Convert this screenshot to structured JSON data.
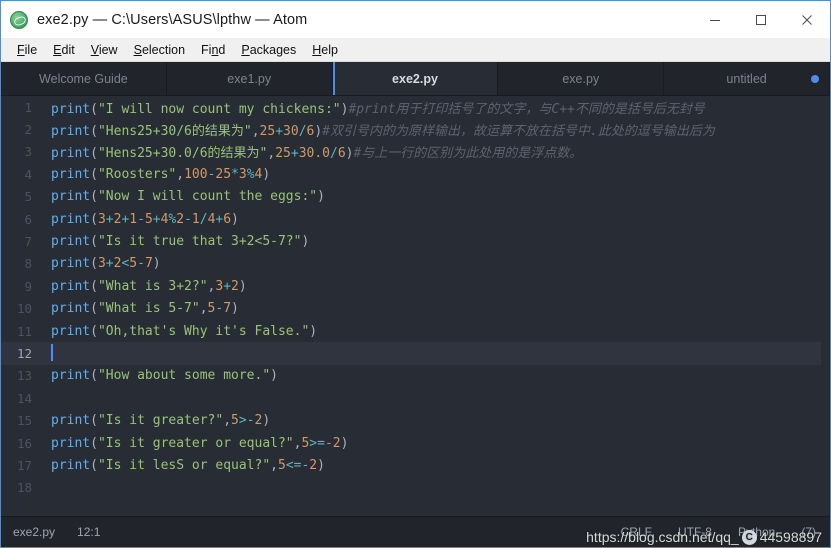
{
  "window": {
    "title": "exe2.py — C:\\Users\\ASUS\\lpthw — Atom",
    "app_icon": "atom-icon",
    "controls": {
      "minimize": "minimize-icon",
      "maximize": "maximize-icon",
      "close": "close-icon"
    }
  },
  "menubar": {
    "items": [
      {
        "label": "File",
        "mnemonic": "F"
      },
      {
        "label": "Edit",
        "mnemonic": "E"
      },
      {
        "label": "View",
        "mnemonic": "V"
      },
      {
        "label": "Selection",
        "mnemonic": "S"
      },
      {
        "label": "Find",
        "mnemonic": "n"
      },
      {
        "label": "Packages",
        "mnemonic": "P"
      },
      {
        "label": "Help",
        "mnemonic": "H"
      }
    ]
  },
  "tabs": [
    {
      "label": "Welcome Guide",
      "active": false,
      "modified": false
    },
    {
      "label": "exe1.py",
      "active": false,
      "modified": false
    },
    {
      "label": "exe2.py",
      "active": true,
      "modified": false
    },
    {
      "label": "exe.py",
      "active": false,
      "modified": false
    },
    {
      "label": "untitled",
      "active": false,
      "modified": true
    }
  ],
  "editor": {
    "active_line": 12,
    "lines": [
      {
        "n": "1",
        "tokens": [
          {
            "t": "fn",
            "v": "print"
          },
          {
            "t": "pun",
            "v": "("
          },
          {
            "t": "str",
            "v": "\"I will now count my chickens:\""
          },
          {
            "t": "pun",
            "v": ")"
          },
          {
            "t": "com",
            "v": "#print用于打印括号了的文字，与C++不同的是括号后无封号"
          }
        ]
      },
      {
        "n": "2",
        "tokens": [
          {
            "t": "fn",
            "v": "print"
          },
          {
            "t": "pun",
            "v": "("
          },
          {
            "t": "str",
            "v": "\"Hens25+30/6的结果为\""
          },
          {
            "t": "pun",
            "v": ","
          },
          {
            "t": "num",
            "v": "25"
          },
          {
            "t": "op",
            "v": "+"
          },
          {
            "t": "num",
            "v": "30"
          },
          {
            "t": "op",
            "v": "/"
          },
          {
            "t": "num",
            "v": "6"
          },
          {
            "t": "pun",
            "v": ")"
          },
          {
            "t": "com",
            "v": "#双引号内的为原样输出，故运算不放在括号中.此处的逗号输出后为"
          }
        ]
      },
      {
        "n": "3",
        "tokens": [
          {
            "t": "fn",
            "v": "print"
          },
          {
            "t": "pun",
            "v": "("
          },
          {
            "t": "str",
            "v": "\"Hens25+30.0/6的结果为\""
          },
          {
            "t": "pun",
            "v": ","
          },
          {
            "t": "num",
            "v": "25"
          },
          {
            "t": "op",
            "v": "+"
          },
          {
            "t": "num",
            "v": "30.0"
          },
          {
            "t": "op",
            "v": "/"
          },
          {
            "t": "num",
            "v": "6"
          },
          {
            "t": "pun",
            "v": ")"
          },
          {
            "t": "com",
            "v": "#与上一行的区别为此处用的是浮点数。"
          }
        ]
      },
      {
        "n": "4",
        "tokens": [
          {
            "t": "fn",
            "v": "print"
          },
          {
            "t": "pun",
            "v": "("
          },
          {
            "t": "str",
            "v": "\"Roosters\""
          },
          {
            "t": "pun",
            "v": ","
          },
          {
            "t": "num",
            "v": "100"
          },
          {
            "t": "op",
            "v": "-"
          },
          {
            "t": "num",
            "v": "25"
          },
          {
            "t": "op",
            "v": "*"
          },
          {
            "t": "num",
            "v": "3"
          },
          {
            "t": "op",
            "v": "%"
          },
          {
            "t": "num",
            "v": "4"
          },
          {
            "t": "pun",
            "v": ")"
          }
        ]
      },
      {
        "n": "5",
        "tokens": [
          {
            "t": "fn",
            "v": "print"
          },
          {
            "t": "pun",
            "v": "("
          },
          {
            "t": "str",
            "v": "\"Now I will count the eggs:\""
          },
          {
            "t": "pun",
            "v": ")"
          }
        ]
      },
      {
        "n": "6",
        "tokens": [
          {
            "t": "fn",
            "v": "print"
          },
          {
            "t": "pun",
            "v": "("
          },
          {
            "t": "num",
            "v": "3"
          },
          {
            "t": "op",
            "v": "+"
          },
          {
            "t": "num",
            "v": "2"
          },
          {
            "t": "op",
            "v": "+"
          },
          {
            "t": "num",
            "v": "1"
          },
          {
            "t": "op",
            "v": "-"
          },
          {
            "t": "num",
            "v": "5"
          },
          {
            "t": "op",
            "v": "+"
          },
          {
            "t": "num",
            "v": "4"
          },
          {
            "t": "op",
            "v": "%"
          },
          {
            "t": "num",
            "v": "2"
          },
          {
            "t": "op",
            "v": "-"
          },
          {
            "t": "num",
            "v": "1"
          },
          {
            "t": "op",
            "v": "/"
          },
          {
            "t": "num",
            "v": "4"
          },
          {
            "t": "op",
            "v": "+"
          },
          {
            "t": "num",
            "v": "6"
          },
          {
            "t": "pun",
            "v": ")"
          }
        ]
      },
      {
        "n": "7",
        "tokens": [
          {
            "t": "fn",
            "v": "print"
          },
          {
            "t": "pun",
            "v": "("
          },
          {
            "t": "str",
            "v": "\"Is it true that 3+2<5-7?\""
          },
          {
            "t": "pun",
            "v": ")"
          }
        ]
      },
      {
        "n": "8",
        "tokens": [
          {
            "t": "fn",
            "v": "print"
          },
          {
            "t": "pun",
            "v": "("
          },
          {
            "t": "num",
            "v": "3"
          },
          {
            "t": "op",
            "v": "+"
          },
          {
            "t": "num",
            "v": "2"
          },
          {
            "t": "op",
            "v": "<"
          },
          {
            "t": "num",
            "v": "5"
          },
          {
            "t": "op",
            "v": "-"
          },
          {
            "t": "num",
            "v": "7"
          },
          {
            "t": "pun",
            "v": ")"
          }
        ]
      },
      {
        "n": "9",
        "tokens": [
          {
            "t": "fn",
            "v": "print"
          },
          {
            "t": "pun",
            "v": "("
          },
          {
            "t": "str",
            "v": "\"What is 3+2?\""
          },
          {
            "t": "pun",
            "v": ","
          },
          {
            "t": "num",
            "v": "3"
          },
          {
            "t": "op",
            "v": "+"
          },
          {
            "t": "num",
            "v": "2"
          },
          {
            "t": "pun",
            "v": ")"
          }
        ]
      },
      {
        "n": "10",
        "tokens": [
          {
            "t": "fn",
            "v": "print"
          },
          {
            "t": "pun",
            "v": "("
          },
          {
            "t": "str",
            "v": "\"What is 5-7\""
          },
          {
            "t": "pun",
            "v": ","
          },
          {
            "t": "num",
            "v": "5"
          },
          {
            "t": "op",
            "v": "-"
          },
          {
            "t": "num",
            "v": "7"
          },
          {
            "t": "pun",
            "v": ")"
          }
        ]
      },
      {
        "n": "11",
        "tokens": [
          {
            "t": "fn",
            "v": "print"
          },
          {
            "t": "pun",
            "v": "("
          },
          {
            "t": "str",
            "v": "\"Oh,that's Why it's False.\""
          },
          {
            "t": "pun",
            "v": ")"
          }
        ]
      },
      {
        "n": "12",
        "tokens": [],
        "cursor": true
      },
      {
        "n": "13",
        "tokens": [
          {
            "t": "fn",
            "v": "print"
          },
          {
            "t": "pun",
            "v": "("
          },
          {
            "t": "str",
            "v": "\"How about some more.\""
          },
          {
            "t": "pun",
            "v": ")"
          }
        ]
      },
      {
        "n": "14",
        "tokens": []
      },
      {
        "n": "15",
        "tokens": [
          {
            "t": "fn",
            "v": "print"
          },
          {
            "t": "pun",
            "v": "("
          },
          {
            "t": "str",
            "v": "\"Is it greater?\""
          },
          {
            "t": "pun",
            "v": ","
          },
          {
            "t": "num",
            "v": "5"
          },
          {
            "t": "op",
            "v": ">"
          },
          {
            "t": "op",
            "v": "-"
          },
          {
            "t": "num",
            "v": "2"
          },
          {
            "t": "pun",
            "v": ")"
          }
        ]
      },
      {
        "n": "16",
        "tokens": [
          {
            "t": "fn",
            "v": "print"
          },
          {
            "t": "pun",
            "v": "("
          },
          {
            "t": "str",
            "v": "\"Is it greater or equal?\""
          },
          {
            "t": "pun",
            "v": ","
          },
          {
            "t": "num",
            "v": "5"
          },
          {
            "t": "op",
            "v": ">="
          },
          {
            "t": "op",
            "v": "-"
          },
          {
            "t": "num",
            "v": "2"
          },
          {
            "t": "pun",
            "v": ")"
          }
        ]
      },
      {
        "n": "17",
        "tokens": [
          {
            "t": "fn",
            "v": "print"
          },
          {
            "t": "pun",
            "v": "("
          },
          {
            "t": "str",
            "v": "\"Is it lesS or equal?\""
          },
          {
            "t": "pun",
            "v": ","
          },
          {
            "t": "num",
            "v": "5"
          },
          {
            "t": "op",
            "v": "<="
          },
          {
            "t": "op",
            "v": "-"
          },
          {
            "t": "num",
            "v": "2"
          },
          {
            "t": "pun",
            "v": ")"
          }
        ]
      },
      {
        "n": "18",
        "tokens": []
      }
    ]
  },
  "statusbar": {
    "filename": "exe2.py",
    "cursor_position": "12:1",
    "line_ending": "CRLF",
    "encoding": "UTF-8",
    "grammar": "Python",
    "issues": "(7)"
  },
  "watermark": {
    "prefix": "https://blog.csdn.net/qq_",
    "logo": "csdn-logo-icon",
    "suffix": "44598897"
  },
  "colors": {
    "accent": "#4d8ee8",
    "editor_bg": "#282c34",
    "chrome_bg": "#21252b",
    "fn": "#61afef",
    "string": "#98c379",
    "number": "#d19a66",
    "operator": "#56b6c2",
    "comment": "#5c6370",
    "cursor": "#528bff"
  }
}
